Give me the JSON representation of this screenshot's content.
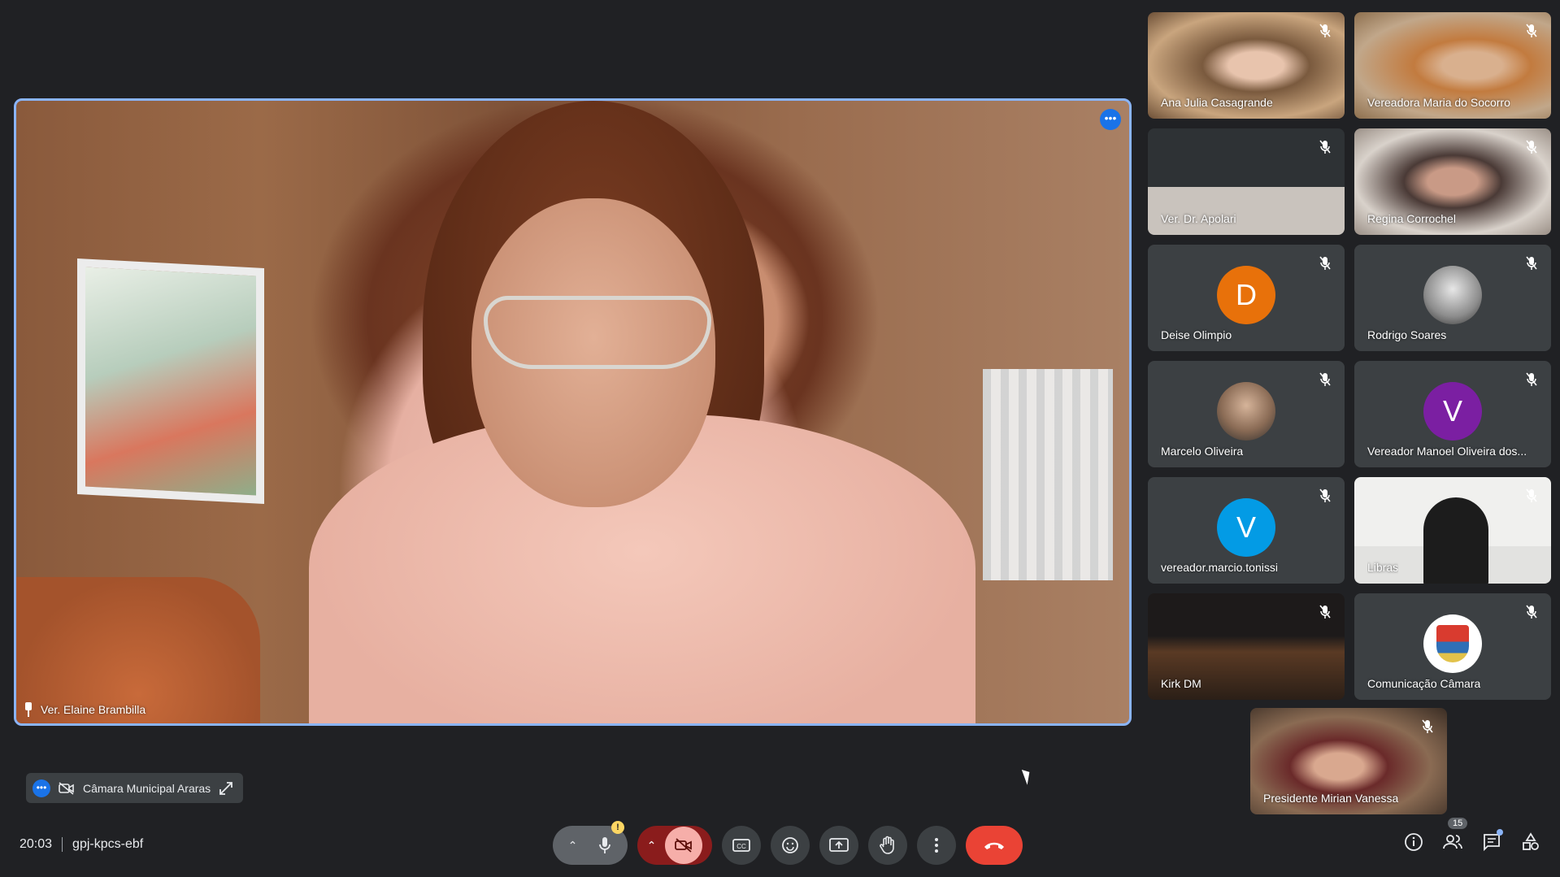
{
  "main_speaker": {
    "name": "Ver. Elaine Brambilla",
    "more_options_glyph": "•••",
    "pin_icon": "pin-icon"
  },
  "participants": [
    {
      "name": "Ana Julia Casagrande",
      "kind": "video",
      "muted": true
    },
    {
      "name": "Vereadora Maria do Socorro",
      "kind": "video",
      "muted": true
    },
    {
      "name": "Ver. Dr. Apolari",
      "kind": "video",
      "muted": true
    },
    {
      "name": "Regina Corrochel",
      "kind": "video",
      "muted": true
    },
    {
      "name": "Deise Olimpio",
      "kind": "avatar",
      "initial": "D",
      "color": "#e8710a",
      "muted": true
    },
    {
      "name": "Rodrigo Soares",
      "kind": "photo",
      "muted": true
    },
    {
      "name": "Marcelo Oliveira",
      "kind": "photo",
      "muted": true
    },
    {
      "name": "Vereador Manoel Oliveira dos...",
      "kind": "avatar",
      "initial": "V",
      "color": "#7b1fa2",
      "muted": true
    },
    {
      "name": "vereador.marcio.tonissi",
      "kind": "avatar",
      "initial": "V",
      "color": "#039be5",
      "muted": true
    },
    {
      "name": "Libras",
      "kind": "video",
      "muted": true
    },
    {
      "name": "Kirk DM",
      "kind": "video",
      "muted": true
    },
    {
      "name": "Comunicação Câmara",
      "kind": "crest",
      "muted": true
    },
    {
      "name": "Presidente Mirian Vanessa",
      "kind": "video",
      "muted": true
    }
  ],
  "floating_self": {
    "label": "Câmara Municipal Araras"
  },
  "meeting": {
    "time": "20:03",
    "code": "gpj-kpcs-ebf"
  },
  "controls": {
    "mic_warning": "!",
    "people_count": "15"
  },
  "colors": {
    "background": "#202124",
    "accent": "#8ab4f8",
    "end_call": "#ea4335"
  }
}
